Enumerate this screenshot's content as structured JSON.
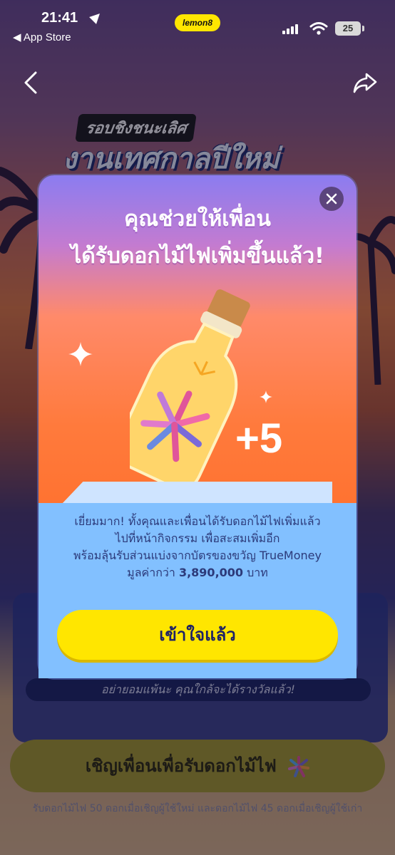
{
  "status_bar": {
    "time": "21:41",
    "back_app": "◀ App Store",
    "lemon8_badge": "lemon8",
    "battery": "25"
  },
  "header": {
    "back_icon": "chevron-left-icon",
    "share_icon": "share-icon"
  },
  "banner": {
    "subtitle": "รอบชิงชนะเลิศ",
    "title": "งานเทศกาลปีใหม่"
  },
  "modal": {
    "title_line1": "คุณช่วยให้เพื่อน",
    "title_line2": "ได้รับดอกไม้ไฟเพิ่มขึ้นแล้ว!",
    "reward": "+5",
    "message_line1": "เยี่ยมมาก! ทั้งคุณและเพื่อนได้รับดอกไม้ไฟเพิ่มแล้ว",
    "message_line2": "ไปที่หน้ากิจกรรม เพื่อสะสมเพิ่มอีก",
    "message_line3": "พร้อมลุ้นรับส่วนแบ่งจากบัตรของขวัญ TrueMoney",
    "message_line4_prefix": "มูลค่ากว่า ",
    "message_amount": "3,890,000",
    "message_line4_suffix": " บาท",
    "confirm_label": "เข้าใจแล้ว",
    "close_icon": "close-icon"
  },
  "background_page": {
    "tip": "อย่ายอมแพ้นะ คุณใกล้จะได้รางวัลแล้ว!",
    "invite_label": "เชิญเพื่อนเพื่อรับดอกไม้ไฟ",
    "footnote": "รับดอกไม้ไฟ 50 ดอกเมื่อเชิญผู้ใช้ใหม่ และดอกไม้ไฟ 45 ดอกเมื่อเชิญผู้ใช้เก่า"
  },
  "colors": {
    "accent_yellow": "#ffe600",
    "text_navy": "#1e2266",
    "modal_orange": "#ff7a3c",
    "message_blue": "#82c0ff"
  }
}
